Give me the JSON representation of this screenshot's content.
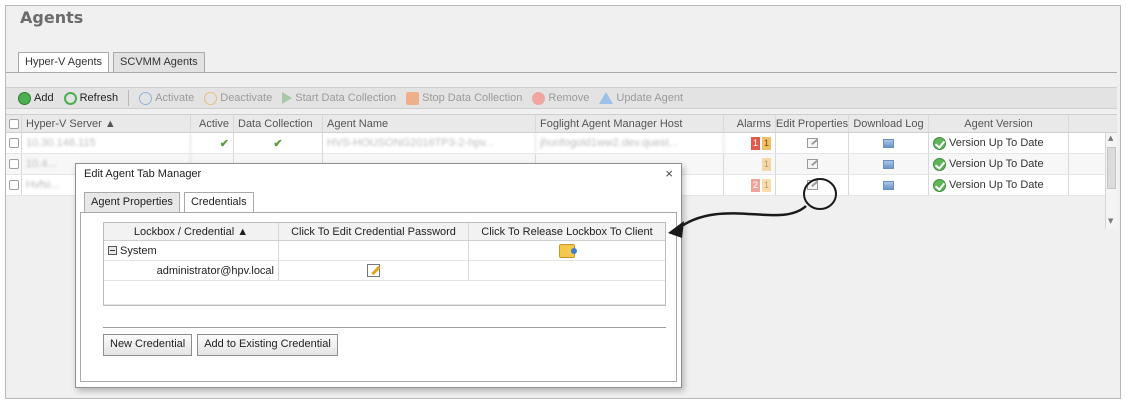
{
  "page": {
    "title": "Agents"
  },
  "tabs": [
    {
      "label": "Hyper-V Agents",
      "active": true
    },
    {
      "label": "SCVMM Agents",
      "active": false
    }
  ],
  "toolbar": {
    "add": "Add",
    "refresh": "Refresh",
    "activate": "Activate",
    "deactivate": "Deactivate",
    "start_collection": "Start Data Collection",
    "stop_collection": "Stop Data Collection",
    "remove": "Remove",
    "update": "Update Agent"
  },
  "grid": {
    "columns": {
      "server": "Hyper-V Server ▲",
      "active": "Active",
      "data_collection": "Data Collection",
      "agent_name": "Agent Name",
      "host": "Foglight Agent Manager Host",
      "alarms": "Alarms",
      "edit": "Edit Properties",
      "download": "Download Log",
      "version": "Agent Version"
    },
    "rows": [
      {
        "server": "10.30.148.115",
        "agent": "HVS-HOUSONG2016TP3-2-hpv...",
        "host": "jhunfogold1ww2.dev.quest...",
        "alarm_red": "1",
        "alarm_orange": "1",
        "version": "Version Up To Date"
      },
      {
        "server": "10.4...",
        "agent": "",
        "host": "",
        "alarm_red": "",
        "alarm_orange": "1",
        "version": "Version Up To Date"
      },
      {
        "server": "Hvfsi...",
        "agent": "",
        "host": "...",
        "alarm_red": "2",
        "alarm_orange": "1",
        "version": "Version Up To Date"
      }
    ]
  },
  "dialog": {
    "title": "Edit Agent Tab Manager",
    "close": "×",
    "tabs": [
      {
        "label": "Agent Properties",
        "active": false
      },
      {
        "label": "Credentials",
        "active": true
      }
    ],
    "table": {
      "col1": "Lockbox / Credential ▲",
      "col2": "Click To Edit Credential Password",
      "col3": "Click To Release Lockbox To Client",
      "group": "System",
      "credential": "administrator@hpv.local"
    },
    "buttons": {
      "new_credential": "New Credential",
      "add_existing": "Add to Existing Credential"
    }
  },
  "colors": {
    "accent_green": "#5fb55a",
    "alarm_red": "#e15a4a",
    "alarm_orange": "#f3c06a",
    "lockbox_yellow": "#f2c94c"
  }
}
